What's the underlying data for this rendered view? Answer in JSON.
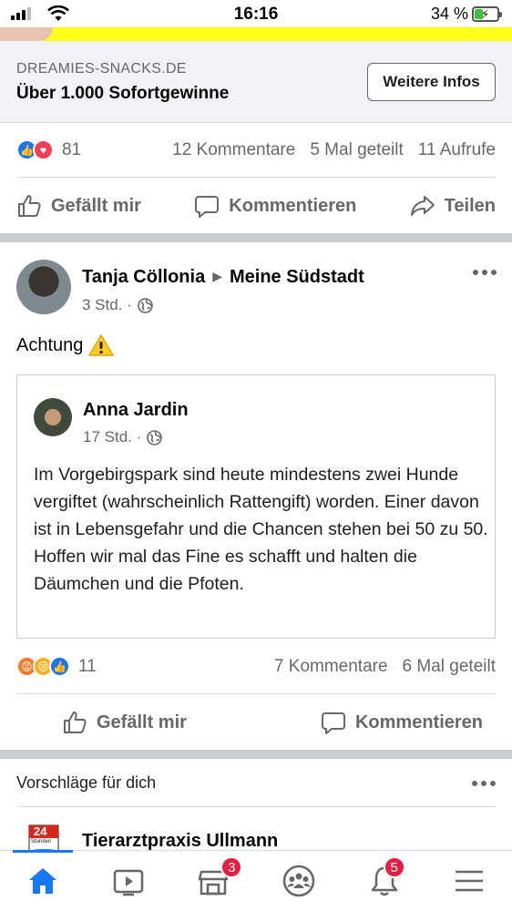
{
  "status_bar": {
    "time": "16:16",
    "battery": "34 %"
  },
  "ad": {
    "domain": "DREAMIES-SNACKS.DE",
    "headline": "Über 1.000 Sofortgewinne",
    "cta": "Weitere Infos"
  },
  "ad_stats": {
    "reactions": "81",
    "comments": "12 Kommentare",
    "shares": "5 Mal geteilt",
    "views": "11 Aufrufe"
  },
  "ad_actions": {
    "like": "Gefällt mir",
    "comment": "Kommentieren",
    "share": "Teilen"
  },
  "post": {
    "author": "Tanja Cöllonia",
    "group": "Meine Südstadt",
    "time": "3 Std. ·",
    "text": "Achtung",
    "shared": {
      "author": "Anna Jardin",
      "time": "17 Std. ·",
      "body": "Im Vorgebirgspark sind heute mindestens zwei Hunde vergiftet (wahrscheinlich Rattengift) worden. Einer davon ist in Lebensgefahr und die Chancen stehen bei 50 zu 50. Hoffen wir mal das Fine es schafft und halten die Däumchen und die Pfoten."
    },
    "stats": {
      "reactions": "11",
      "comments": "7 Kommentare",
      "shares": "6 Mal geteilt"
    },
    "actions": {
      "like": "Gefällt mir",
      "comment": "Kommentieren"
    }
  },
  "suggestions": {
    "title": "Vorschläge für dich",
    "page_name": "Tierarztpraxis Ullmann",
    "logo_text": "24",
    "logo_subtext": "Stunden"
  },
  "tab_bar": {
    "tabs": [
      {
        "icon": "home-icon",
        "active": true
      },
      {
        "icon": "watch-icon"
      },
      {
        "icon": "marketplace-icon",
        "badge": "3"
      },
      {
        "icon": "groups-icon"
      },
      {
        "icon": "notifications-icon",
        "badge": "5"
      },
      {
        "icon": "menu-icon"
      }
    ]
  },
  "colors": {
    "accent": "#1877f2",
    "badge": "#e41e3f",
    "ad_banner": "#ffff1a"
  }
}
